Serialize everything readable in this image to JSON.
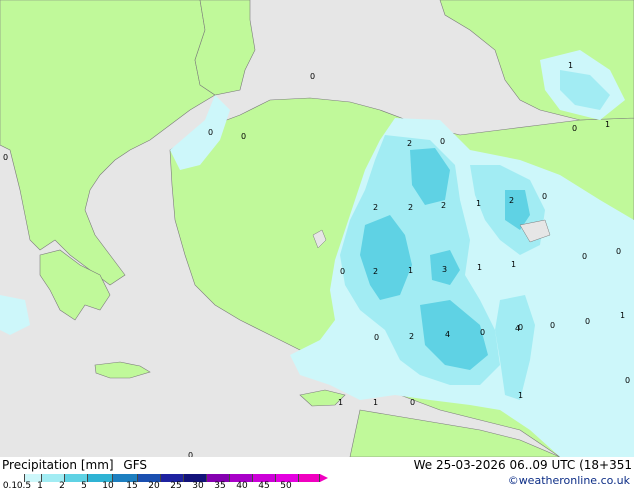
{
  "title": "Precipitation [mm]",
  "model": "GFS",
  "valid_time": "We 25-03-2026 06..09 UTC (18+351",
  "credit": "©weatheronline.co.uk",
  "colors": {
    "land": "#c0f99a",
    "sea": "#e6e6e6",
    "precip_light": "#cdf7fa",
    "precip_mid": "#a2ecf3",
    "precip_heavy": "#5fd2e4",
    "coast": "#7b7b7b",
    "credit": "#0c2d86"
  },
  "legend": {
    "ticks": [
      "0.1",
      "0.5",
      "1",
      "2",
      "5",
      "10",
      "15",
      "20",
      "25",
      "30",
      "35",
      "40",
      "45",
      "50"
    ],
    "colors": [
      "#ffffff",
      "#cdf7fa",
      "#a2ecf3",
      "#5fd2e4",
      "#2fb3d4",
      "#1d7fc0",
      "#1a4fb0",
      "#1e22a0",
      "#12127a",
      "#8400b0",
      "#a800c8",
      "#cc00d8",
      "#e400e0",
      "#f000c0"
    ]
  },
  "contour_labels": [
    {
      "text": "0"
    },
    {
      "text": "0"
    },
    {
      "text": "0"
    },
    {
      "text": "0"
    },
    {
      "text": "0"
    },
    {
      "text": "1"
    },
    {
      "text": "0"
    },
    {
      "text": "1"
    },
    {
      "text": "2"
    },
    {
      "text": "0"
    },
    {
      "text": "2"
    },
    {
      "text": "2"
    },
    {
      "text": "2"
    },
    {
      "text": "1"
    },
    {
      "text": "2"
    },
    {
      "text": "0"
    },
    {
      "text": "0"
    },
    {
      "text": "2"
    },
    {
      "text": "1"
    },
    {
      "text": "3"
    },
    {
      "text": "1"
    },
    {
      "text": "1"
    },
    {
      "text": "0"
    },
    {
      "text": "0"
    },
    {
      "text": "1"
    },
    {
      "text": "0"
    },
    {
      "text": "2"
    },
    {
      "text": "4"
    },
    {
      "text": "0"
    },
    {
      "text": "4"
    },
    {
      "text": "0"
    },
    {
      "text": "0"
    },
    {
      "text": "1"
    },
    {
      "text": "1"
    },
    {
      "text": "0"
    },
    {
      "text": "1"
    },
    {
      "text": "0"
    },
    {
      "text": "0"
    }
  ]
}
